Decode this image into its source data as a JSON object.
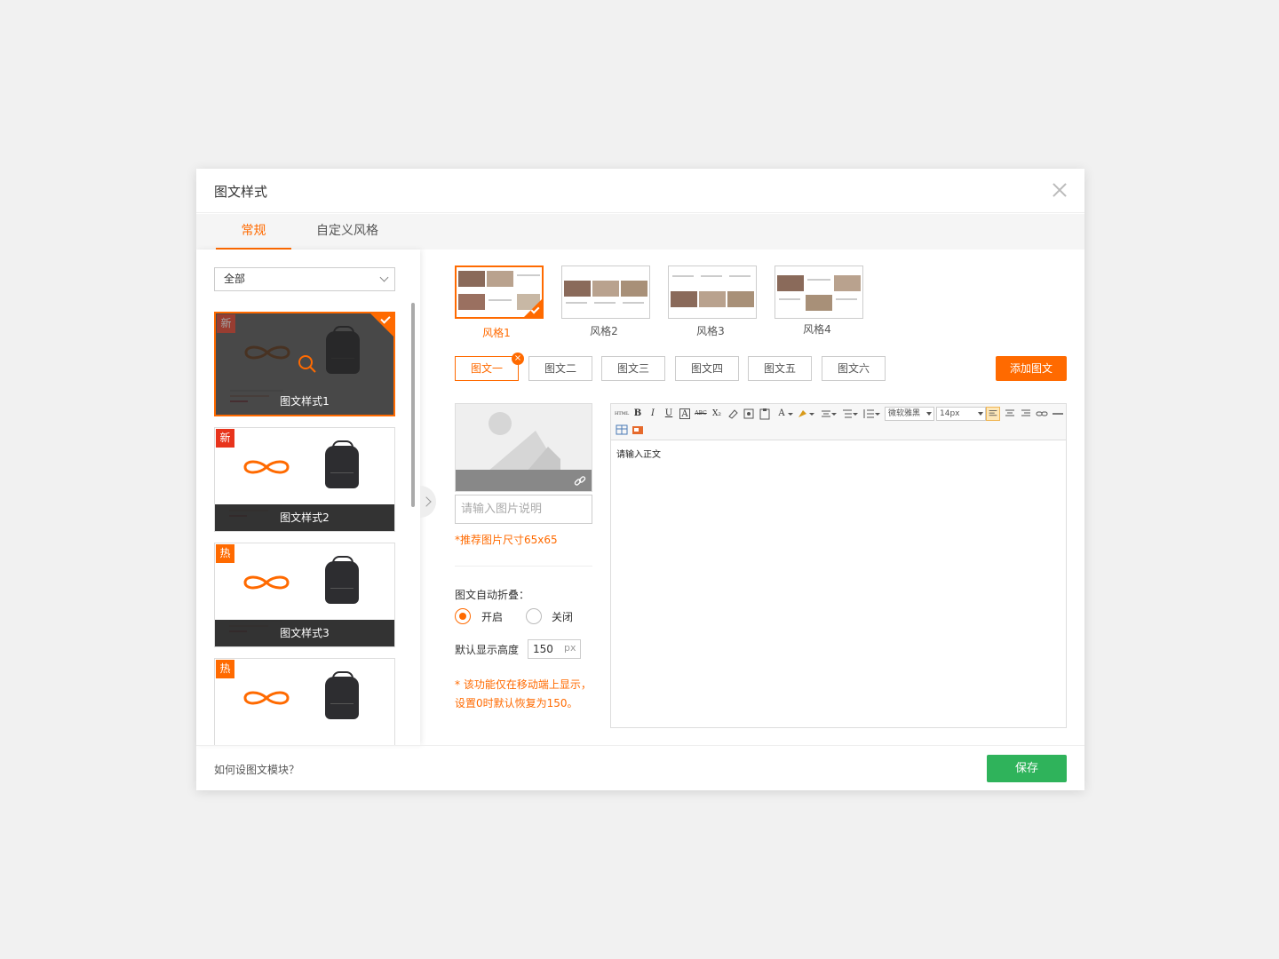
{
  "dialog": {
    "title": "图文样式",
    "close_icon": "close-icon"
  },
  "tabs": [
    {
      "label": "常规",
      "active": true
    },
    {
      "label": "自定义风格",
      "active": false
    }
  ],
  "filter": {
    "selected": "全部"
  },
  "cards": [
    {
      "caption": "图文样式1",
      "badge": "新",
      "selected": true
    },
    {
      "caption": "图文样式2",
      "badge": "新",
      "selected": false
    },
    {
      "caption": "图文样式3",
      "badge": "热",
      "selected": false
    },
    {
      "caption": "",
      "badge": "热",
      "selected": false
    }
  ],
  "styles": [
    {
      "label": "风格1",
      "active": true
    },
    {
      "label": "风格2",
      "active": false
    },
    {
      "label": "风格3",
      "active": false
    },
    {
      "label": "风格4",
      "active": false
    }
  ],
  "sub_tabs": [
    "图文一",
    "图文二",
    "图文三",
    "图文四",
    "图文五",
    "图文六"
  ],
  "sub_delete_glyph": "×",
  "add_button": "添加图文",
  "image": {
    "caption_placeholder": "请输入图片说明",
    "hint": "*推荐图片尺寸65x65"
  },
  "fold": {
    "title": "图文自动折叠：",
    "on_label": "开启",
    "off_label": "关闭",
    "selected": "开启",
    "height_label": "默认显示高度",
    "height_value": "150",
    "height_unit": "px",
    "note": "* 该功能仅在移动端上显示，设置0时默认恢复为150。"
  },
  "editor": {
    "toolbar_glyphs": {
      "html": "HTML",
      "bold": "B",
      "italic": "I",
      "underline": "U",
      "font_color": "A",
      "strike": "ABC",
      "sub": "X₂",
      "font_color2": "A"
    },
    "font_family": "微软雅黑",
    "font_size": "14px",
    "body_text": "请输入正文"
  },
  "footer": {
    "help": "如何设图文模块？",
    "save": "保存"
  },
  "colors": {
    "accent": "#ff6a00",
    "save": "#2fb35b",
    "new_badge": "#e8341c",
    "hot_badge": "#ff6a00"
  }
}
